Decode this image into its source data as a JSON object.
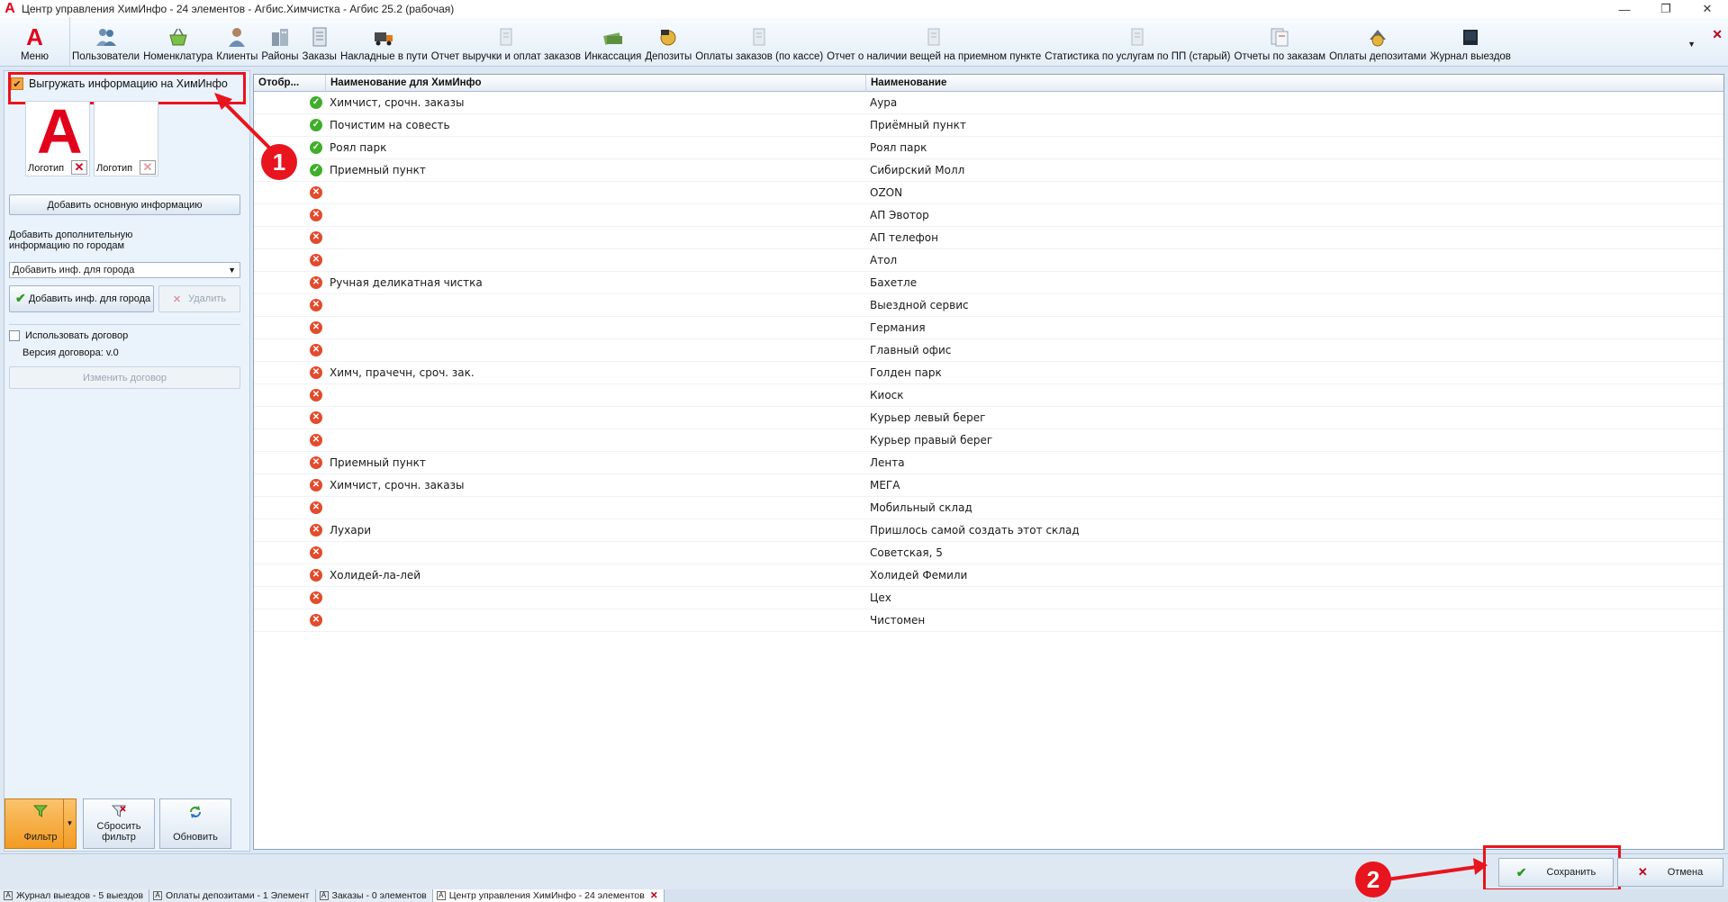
{
  "window": {
    "title": "Центр управления ХимИнфо - 24 элементов - Агбис.Химчистка - Агбис 25.2 (рабочая)"
  },
  "ribbon": {
    "menu_label": "Меню",
    "items": [
      {
        "label": "Пользователи",
        "icon": "users-icon"
      },
      {
        "label": "Номенклатура",
        "icon": "basket-icon"
      },
      {
        "label": "Клиенты",
        "icon": "client-icon"
      },
      {
        "label": "Районы",
        "icon": "buildings-icon"
      },
      {
        "label": "Заказы",
        "icon": "orders-icon"
      },
      {
        "label": "Накладные в пути",
        "icon": "truck-icon"
      },
      {
        "label": "Отчет выручки и оплат заказов",
        "icon": "report-icon"
      },
      {
        "label": "Инкассация",
        "icon": "cash-icon"
      },
      {
        "label": "Депозиты",
        "icon": "deposit-icon"
      },
      {
        "label": "Оплаты заказов (по кассе)",
        "icon": "report-icon"
      },
      {
        "label": "Отчет о наличии вещей на приемном пункте",
        "icon": "report-icon"
      },
      {
        "label": "Статистика по услугам по ПП (старый)",
        "icon": "report-icon"
      },
      {
        "label": "Отчеты по заказам",
        "icon": "reports-icon"
      },
      {
        "label": "Оплаты депозитами",
        "icon": "deposit-pay-icon"
      },
      {
        "label": "Журнал выездов",
        "icon": "journal-icon"
      }
    ]
  },
  "left": {
    "export_checkbox_label": "Выгружать информацию на ХимИнфо",
    "export_checked": true,
    "logo1_label": "Логотип",
    "logo2_label": "Логотип",
    "add_main_info": "Добавить основную информацию",
    "add_city_info_caption": "Добавить дополнительную информацию по городам",
    "city_select_value": "Добавить инф. для города",
    "add_city_button": "Добавить инф. для города",
    "delete_button": "Удалить",
    "use_contract_label": "Использовать договор",
    "contract_version": "Версия договора: v.0",
    "change_contract_button": "Изменить договор",
    "filter_button": "Фильтр",
    "reset_filter_button": "Сбросить фильтр",
    "refresh_button": "Обновить"
  },
  "grid": {
    "columns": [
      "Отобр...",
      "Наименование для ХимИнфо",
      "Наименование"
    ],
    "rows": [
      {
        "shown": true,
        "chem_name": "Химчист, срочн. заказы",
        "name": "Аура"
      },
      {
        "shown": true,
        "chem_name": "Почистим на совесть",
        "name": "Приёмный пункт"
      },
      {
        "shown": true,
        "chem_name": "Роял парк",
        "name": "Роял парк"
      },
      {
        "shown": true,
        "chem_name": "Приемный пункт",
        "name": "Сибирский Молл"
      },
      {
        "shown": false,
        "chem_name": "",
        "name": "OZON"
      },
      {
        "shown": false,
        "chem_name": "",
        "name": "АП Эвотор"
      },
      {
        "shown": false,
        "chem_name": "",
        "name": "АП телефон"
      },
      {
        "shown": false,
        "chem_name": "",
        "name": "Атол"
      },
      {
        "shown": false,
        "chem_name": "Ручная деликатная чистка",
        "name": "Бахетле"
      },
      {
        "shown": false,
        "chem_name": "",
        "name": "Выездной сервис"
      },
      {
        "shown": false,
        "chem_name": "",
        "name": "Германия"
      },
      {
        "shown": false,
        "chem_name": "",
        "name": "Главный офис"
      },
      {
        "shown": false,
        "chem_name": "Химч, прачечн, сроч. зак.",
        "name": "Голден парк"
      },
      {
        "shown": false,
        "chem_name": "",
        "name": "Киоск"
      },
      {
        "shown": false,
        "chem_name": "",
        "name": "Курьер левый берег"
      },
      {
        "shown": false,
        "chem_name": "",
        "name": "Курьер правый берег"
      },
      {
        "shown": false,
        "chem_name": "Приемный пункт",
        "name": "Лента"
      },
      {
        "shown": false,
        "chem_name": "Химчист, срочн. заказы",
        "name": "МЕГА"
      },
      {
        "shown": false,
        "chem_name": "",
        "name": "Мобильный склад"
      },
      {
        "shown": false,
        "chem_name": "Лухари",
        "name": "Пришлось самой создать этот склад"
      },
      {
        "shown": false,
        "chem_name": "",
        "name": "Советская, 5"
      },
      {
        "shown": false,
        "chem_name": "Холидей-ла-лей",
        "name": "Холидей Фемили"
      },
      {
        "shown": false,
        "chem_name": "",
        "name": "Цех"
      },
      {
        "shown": false,
        "chem_name": "",
        "name": "Чистомен"
      }
    ]
  },
  "footer": {
    "save_button": "Сохранить",
    "cancel_button": "Отмена"
  },
  "annotations": {
    "marker1": "1",
    "marker2": "2",
    "color": "#e8141e"
  },
  "tabs": [
    {
      "label": "Журнал выездов - 5 выездов",
      "active": false
    },
    {
      "label": "Оплаты депозитами - 1 Элемент",
      "active": false
    },
    {
      "label": "Заказы - 0 элементов",
      "active": false
    },
    {
      "label": "Центр управления ХимИнфо - 24 элементов",
      "active": true
    }
  ]
}
